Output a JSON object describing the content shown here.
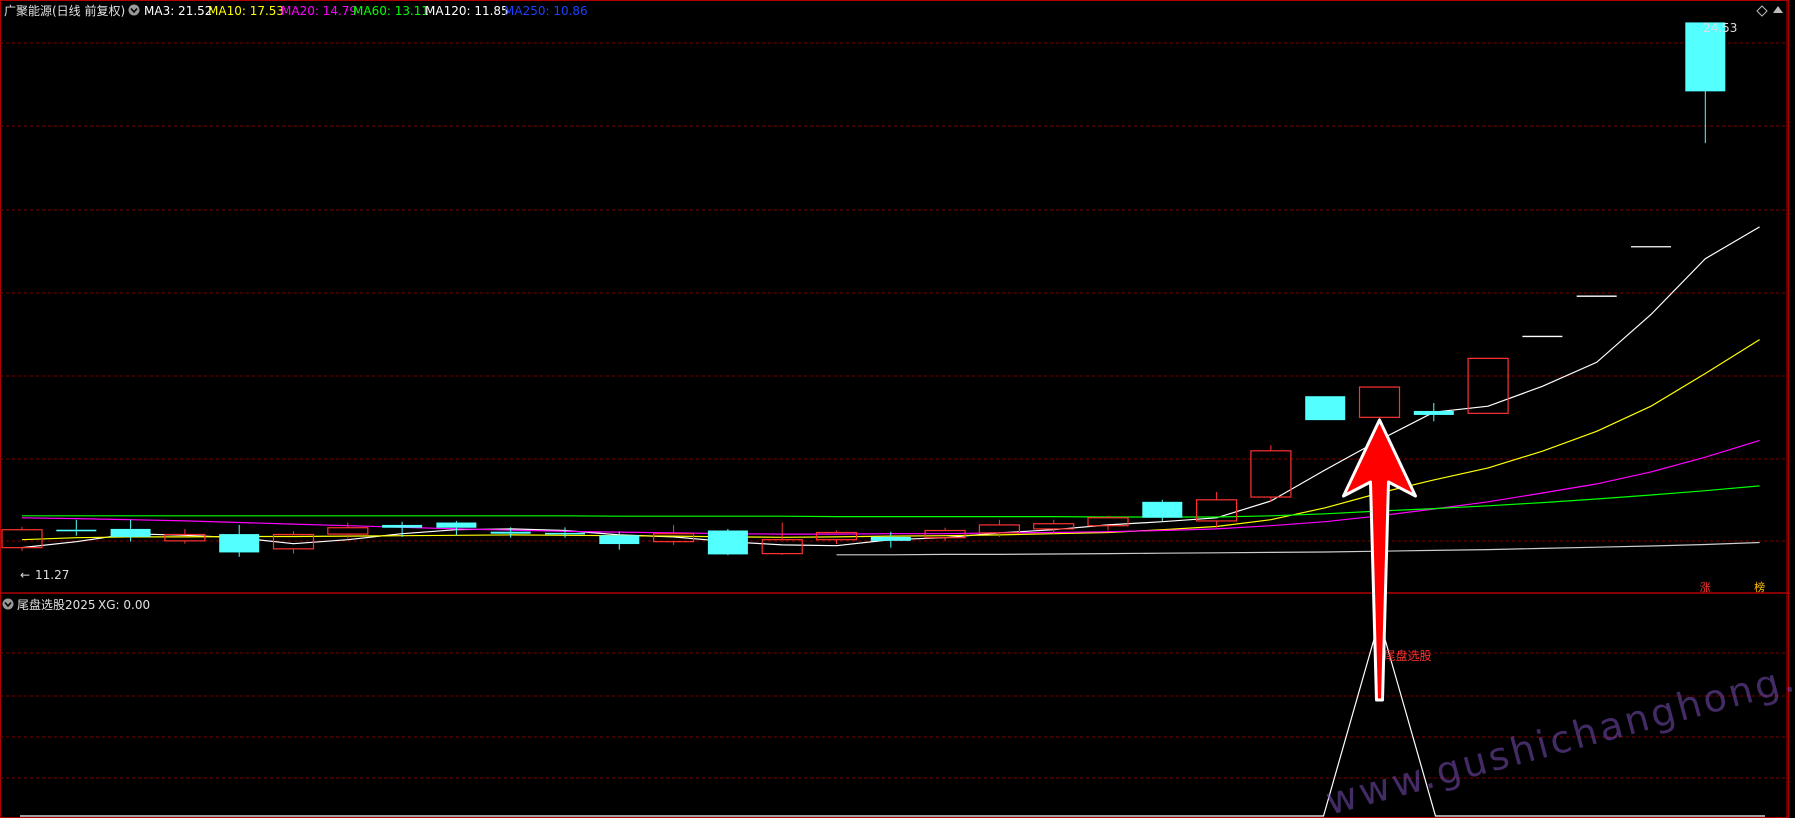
{
  "main_header": {
    "stock_name": "广聚能源(日线 前复权)",
    "ma": [
      {
        "label": "MA3: 21.52",
        "color": "#ffffff"
      },
      {
        "label": "MA10: 17.53",
        "color": "#ffff00"
      },
      {
        "label": "MA20: 14.79",
        "color": "#ff00ff"
      },
      {
        "label": "MA60: 13.11",
        "color": "#00ff00"
      },
      {
        "label": "MA120: 11.85",
        "color": "#ffffff"
      },
      {
        "label": "MA250: 10.86",
        "color": "#1f3fff"
      }
    ]
  },
  "sub_header": {
    "indicator": "尾盘选股2025",
    "value": "XG: 0.00"
  },
  "colors": {
    "up": "#ff3232",
    "down": "#54ffff",
    "grid": "#7a0000",
    "border": "#b00000",
    "arrow": "#ff0000"
  },
  "icons": [
    "collapse-icon",
    "diamond-icon",
    "up-arrow-icon"
  ],
  "chart_data": {
    "type": "candlestick",
    "price_range": [
      10.9,
      24.53
    ],
    "high_label": "24.53",
    "low_label": "11.27",
    "candles": [
      [
        11.35,
        11.8,
        11.87,
        11.27
      ],
      [
        11.8,
        11.76,
        12.05,
        11.65
      ],
      [
        11.82,
        11.62,
        12.05,
        11.5
      ],
      [
        11.52,
        11.68,
        11.82,
        11.45
      ],
      [
        11.69,
        11.23,
        11.92,
        11.12
      ],
      [
        11.32,
        11.68,
        11.76,
        11.2
      ],
      [
        11.69,
        11.85,
        11.98,
        11.58
      ],
      [
        11.92,
        11.85,
        12.0,
        11.62
      ],
      [
        11.98,
        11.85,
        12.02,
        11.66
      ],
      [
        11.75,
        11.7,
        11.86,
        11.6
      ],
      [
        11.72,
        11.7,
        11.86,
        11.6
      ],
      [
        11.66,
        11.44,
        11.75,
        11.3
      ],
      [
        11.5,
        11.7,
        11.92,
        11.42
      ],
      [
        11.78,
        11.18,
        11.82,
        11.16
      ],
      [
        11.2,
        11.55,
        11.98,
        11.17
      ],
      [
        11.55,
        11.73,
        11.78,
        11.44
      ],
      [
        11.62,
        11.52,
        11.75,
        11.35
      ],
      [
        11.6,
        11.78,
        11.85,
        11.52
      ],
      [
        11.72,
        11.92,
        12.05,
        11.62
      ],
      [
        11.82,
        11.95,
        12.05,
        11.7
      ],
      [
        11.9,
        12.1,
        12.15,
        11.78
      ],
      [
        12.5,
        12.1,
        12.55,
        12.02
      ],
      [
        12.02,
        12.55,
        12.75,
        11.85
      ],
      [
        12.62,
        13.78,
        13.92,
        12.5
      ],
      [
        15.15,
        14.55,
        15.15,
        14.55
      ],
      [
        14.62,
        15.38,
        15.38,
        14.17
      ],
      [
        14.78,
        14.68,
        14.98,
        14.52
      ],
      [
        14.72,
        16.1,
        16.1,
        14.72
      ],
      [
        16.65,
        16.65,
        16.65,
        16.65
      ],
      [
        17.66,
        17.66,
        17.66,
        17.66
      ],
      [
        18.9,
        18.9,
        18.9,
        18.9
      ],
      [
        24.53,
        22.8,
        24.53,
        21.5
      ]
    ],
    "ma_lines": [
      {
        "name": "MA3",
        "color": "#ffffff",
        "start": 0,
        "values": [
          11.35,
          11.5,
          11.7,
          11.66,
          11.6,
          11.45,
          11.55,
          11.7,
          11.8,
          11.82,
          11.78,
          11.67,
          11.62,
          11.5,
          11.42,
          11.4,
          11.55,
          11.6,
          11.72,
          11.8,
          11.92,
          12.0,
          12.1,
          12.52,
          13.3,
          14.05,
          14.75,
          14.9,
          15.4,
          16.0,
          17.2,
          18.6,
          19.4
        ]
      },
      {
        "name": "MA10",
        "color": "#ffff00",
        "start": 0,
        "values": [
          11.55,
          11.6,
          11.62,
          11.62,
          11.63,
          11.63,
          11.64,
          11.65,
          11.66,
          11.67,
          11.66,
          11.65,
          11.64,
          11.62,
          11.61,
          11.62,
          11.64,
          11.65,
          11.67,
          11.7,
          11.73,
          11.8,
          11.88,
          12.05,
          12.35,
          12.72,
          13.05,
          13.35,
          13.77,
          14.27,
          14.9,
          15.72,
          16.57
        ]
      },
      {
        "name": "MA20",
        "color": "#ff00ff",
        "start": 0,
        "values": [
          12.1,
          12.08,
          12.05,
          12.02,
          11.98,
          11.94,
          11.9,
          11.86,
          11.82,
          11.79,
          11.76,
          11.74,
          11.72,
          11.7,
          11.69,
          11.69,
          11.7,
          11.7,
          11.72,
          11.73,
          11.75,
          11.78,
          11.82,
          11.9,
          12.0,
          12.15,
          12.32,
          12.5,
          12.72,
          12.95,
          13.25,
          13.62,
          14.04
        ]
      },
      {
        "name": "MA60",
        "color": "#00ff00",
        "start": 0,
        "values": [
          12.15,
          12.15,
          12.15,
          12.15,
          12.15,
          12.15,
          12.15,
          12.15,
          12.15,
          12.15,
          12.15,
          12.14,
          12.14,
          12.14,
          12.14,
          12.13,
          12.13,
          12.13,
          12.13,
          12.13,
          12.12,
          12.12,
          12.12,
          12.15,
          12.2,
          12.27,
          12.33,
          12.4,
          12.48,
          12.57,
          12.67,
          12.78,
          12.9
        ]
      },
      {
        "name": "MA120",
        "color": "#cccccc",
        "start": 15,
        "values": [
          11.17,
          11.17,
          11.18,
          11.18,
          11.19,
          11.2,
          11.21,
          11.22,
          11.23,
          11.24,
          11.26,
          11.28,
          11.3,
          11.33,
          11.36,
          11.39,
          11.43,
          11.48
        ]
      }
    ],
    "signals": [
      {
        "index": 31,
        "label": "涨",
        "color": "#ff3232"
      },
      {
        "index": 32,
        "label": "榜",
        "color": "#ffc000"
      }
    ],
    "xg_signal": {
      "index": 25,
      "label": "尾盘选股"
    },
    "watermark": "www.gushichanghong.com"
  }
}
